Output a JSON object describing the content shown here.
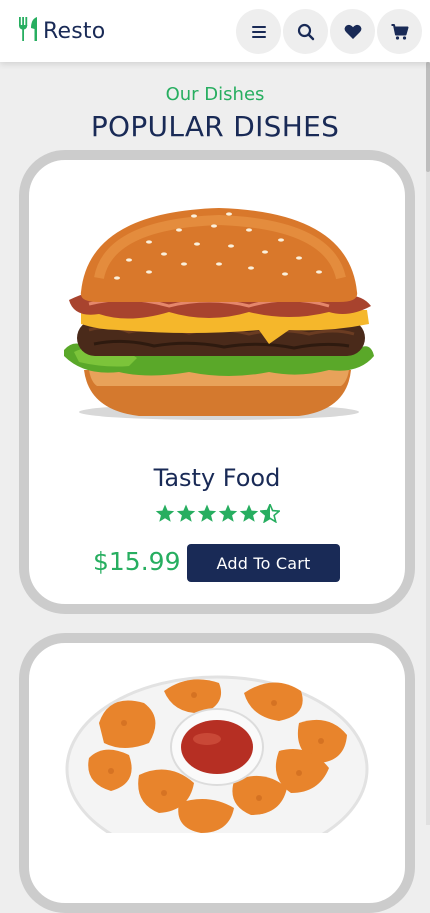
{
  "header": {
    "logo_text": "Resto",
    "logo_icon": "utensils-icon",
    "icons": [
      "menu-icon",
      "search-icon",
      "heart-icon",
      "cart-icon"
    ]
  },
  "section": {
    "subtitle": "Our Dishes",
    "title": "POPULAR DISHES"
  },
  "dishes": [
    {
      "name": "Tasty Food",
      "rating_stars": 4.5,
      "price": "$15.99",
      "button_label": "Add To Cart",
      "image": "burger"
    },
    {
      "image": "chicken nuggets"
    }
  ],
  "colors": {
    "accent": "#27ae60",
    "primary": "#192a56",
    "background": "#eeeeee",
    "card_border": "#cccccc"
  }
}
